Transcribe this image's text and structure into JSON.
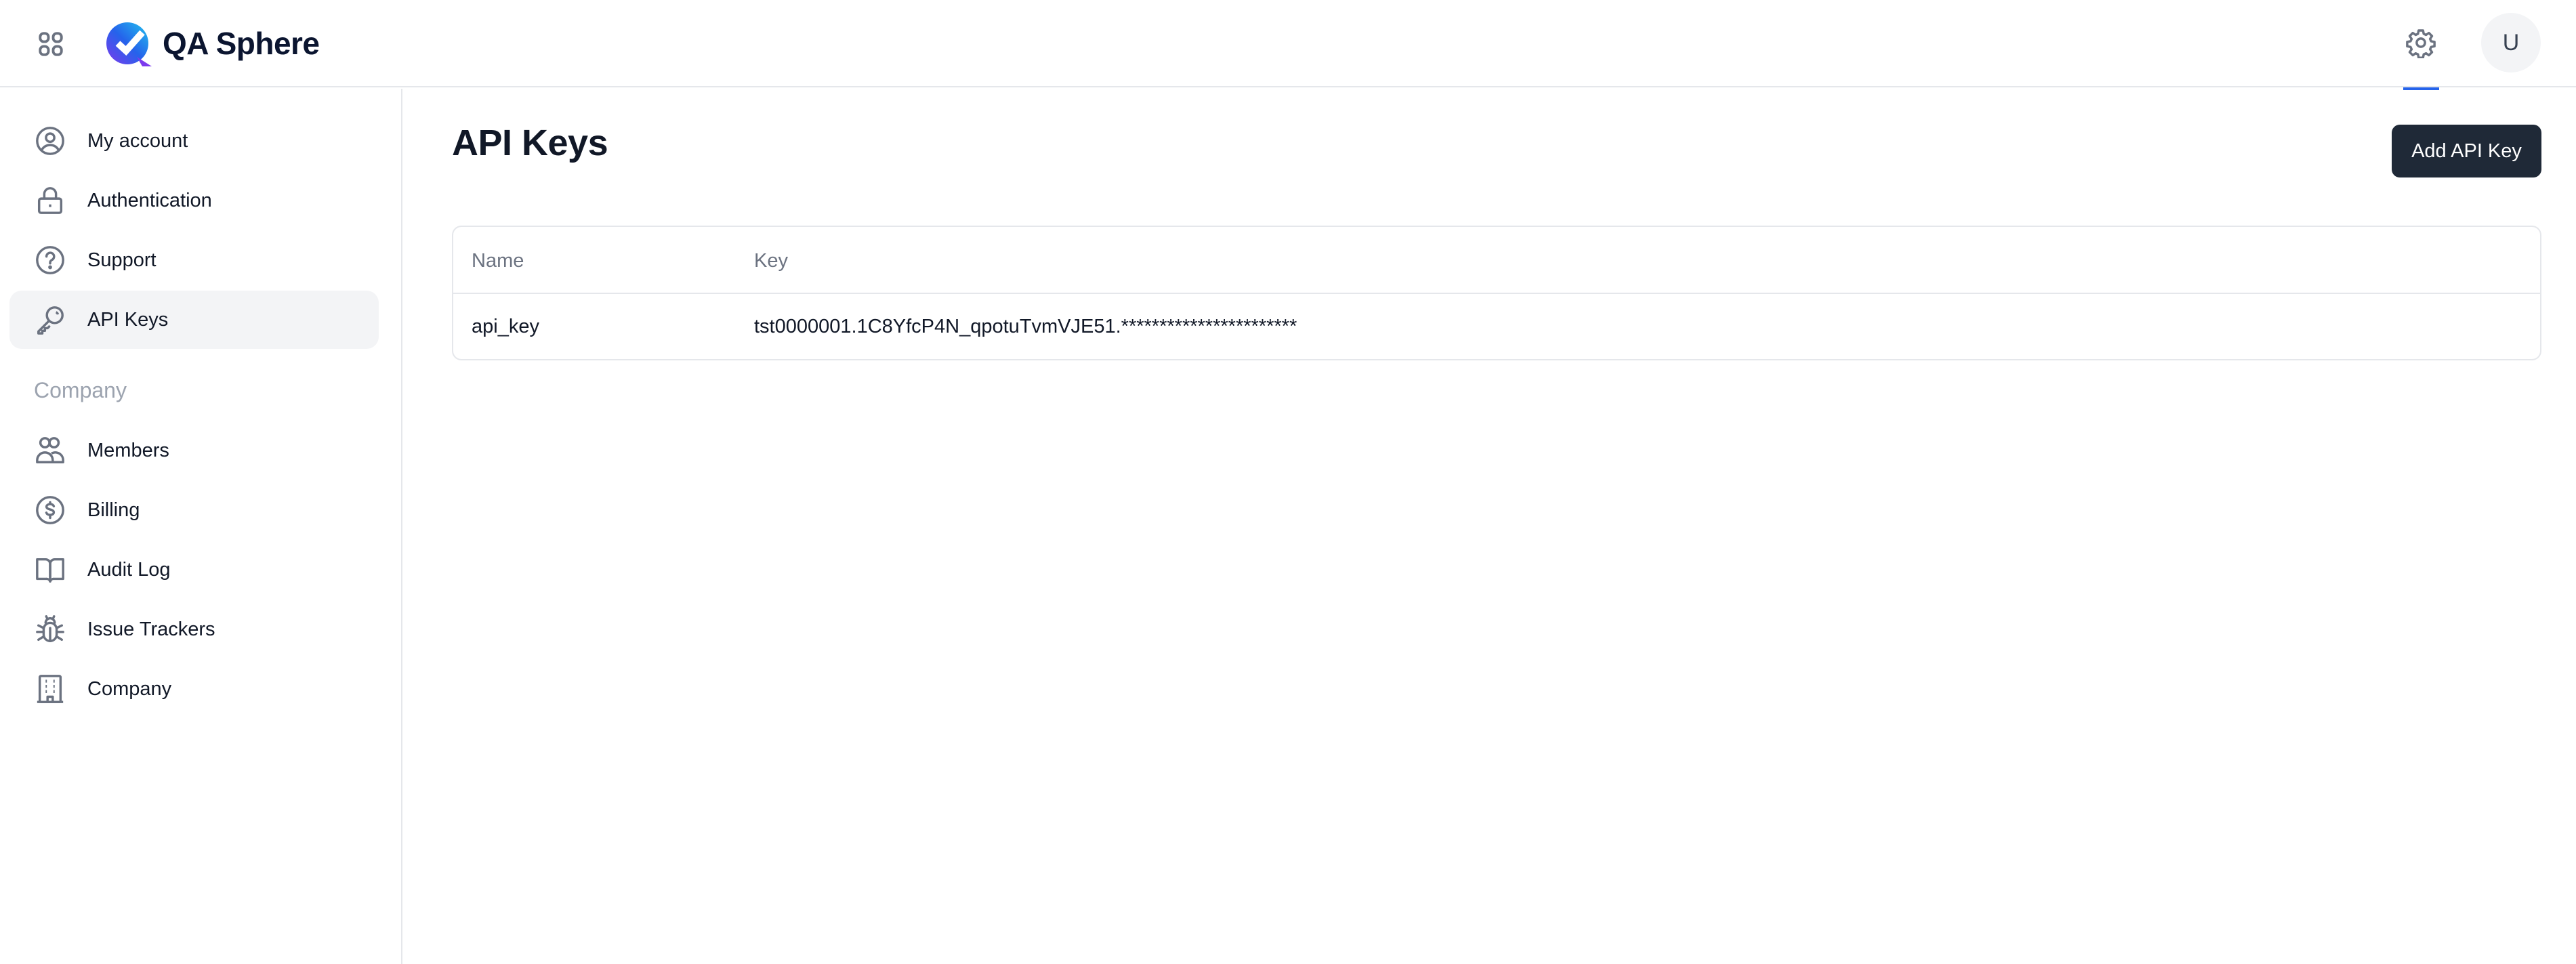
{
  "app": {
    "name": "QA Sphere"
  },
  "header": {
    "apps_icon": "grid-icon",
    "settings_icon": "gear-icon",
    "avatar_initial": "U",
    "accent_color": "#2563eb"
  },
  "sidebar": {
    "account_items": [
      {
        "label": "My account",
        "icon": "user-circle-icon",
        "active": false
      },
      {
        "label": "Authentication",
        "icon": "lock-icon",
        "active": false
      },
      {
        "label": "Support",
        "icon": "question-circle-icon",
        "active": false
      },
      {
        "label": "API Keys",
        "icon": "key-icon",
        "active": true
      }
    ],
    "company_section_label": "Company",
    "company_items": [
      {
        "label": "Members",
        "icon": "users-icon"
      },
      {
        "label": "Billing",
        "icon": "dollar-circle-icon"
      },
      {
        "label": "Audit Log",
        "icon": "book-open-icon"
      },
      {
        "label": "Issue Trackers",
        "icon": "bug-icon"
      },
      {
        "label": "Company",
        "icon": "building-icon"
      }
    ]
  },
  "main": {
    "title": "API Keys",
    "add_button_label": "Add API Key",
    "table": {
      "columns": [
        "Name",
        "Key"
      ],
      "rows": [
        {
          "name": "api_key",
          "key": "tst0000001.1C8YfcP4N_qpotuTvmVJE51.***********************"
        }
      ]
    }
  }
}
